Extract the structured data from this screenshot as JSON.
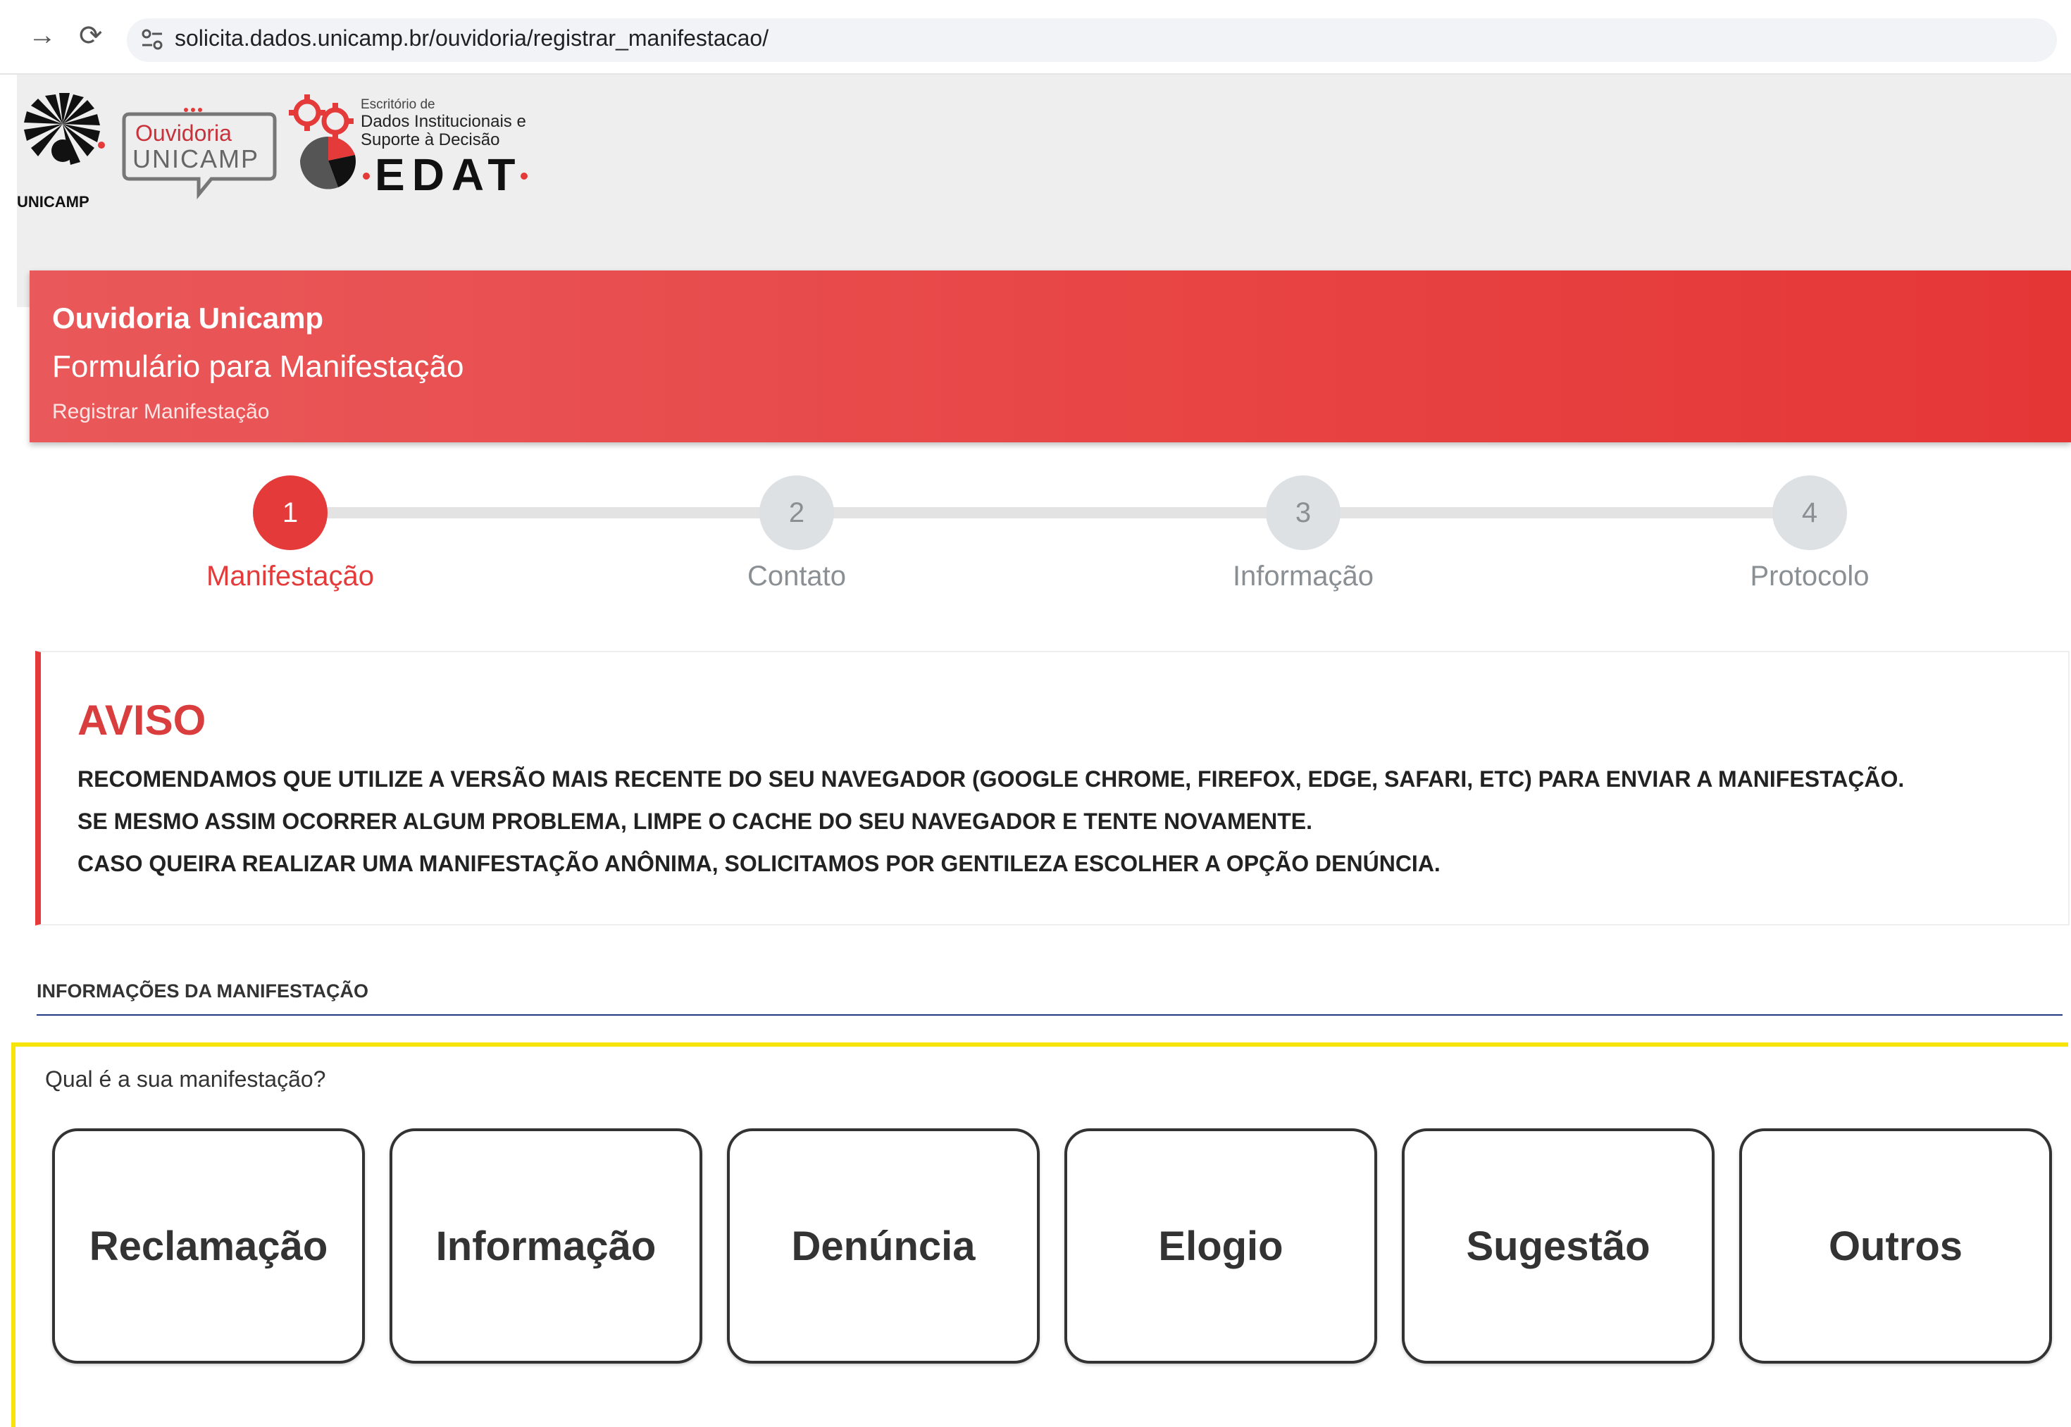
{
  "browser": {
    "url": "solicita.dados.unicamp.br/ouvidoria/registrar_manifestacao/"
  },
  "logos": {
    "unicamp": "UNICAMP",
    "ouvidoria_line1": "Ouvidoria",
    "ouvidoria_line2": "UNICAMP",
    "edat_small_1": "Escritório de",
    "edat_small_2": "Dados Institucionais e",
    "edat_small_3": "Suporte à Decisão",
    "edat_big": "EDAT"
  },
  "banner": {
    "title": "Ouvidoria Unicamp",
    "subtitle": "Formulário para Manifestação",
    "breadcrumb": "Registrar Manifestação"
  },
  "stepper": {
    "steps": [
      {
        "number": "1",
        "label": "Manifestação",
        "active": true
      },
      {
        "number": "2",
        "label": "Contato",
        "active": false
      },
      {
        "number": "3",
        "label": "Informação",
        "active": false
      },
      {
        "number": "4",
        "label": "Protocolo",
        "active": false
      }
    ]
  },
  "aviso": {
    "title": "AVISO",
    "lines": [
      "RECOMENDAMOS QUE UTILIZE A VERSÃO MAIS RECENTE DO SEU NAVEGADOR (GOOGLE CHROME, FIREFOX, EDGE, SAFARI, ETC) PARA ENVIAR A MANIFESTAÇÃO.",
      "SE MESMO ASSIM OCORRER ALGUM PROBLEMA, LIMPE O CACHE DO SEU NAVEGADOR E TENTE NOVAMENTE.",
      "CASO QUEIRA REALIZAR UMA MANIFESTAÇÃO ANÔNIMA, SOLICITAMOS POR GENTILEZA ESCOLHER A OPÇÃO DENÚNCIA."
    ]
  },
  "section": {
    "title": "INFORMAÇÕES DA MANIFESTAÇÃO"
  },
  "question": {
    "label": "Qual é a sua manifestação?",
    "options": [
      "Reclamação",
      "Informação",
      "Denúncia",
      "Elogio",
      "Sugestão",
      "Outros"
    ]
  },
  "colors": {
    "accent": "#e53a3a",
    "highlight": "#f7e409",
    "rule": "#1f3a80"
  },
  "icons": [
    "back-arrow-icon",
    "reload-icon",
    "site-settings-icon"
  ]
}
